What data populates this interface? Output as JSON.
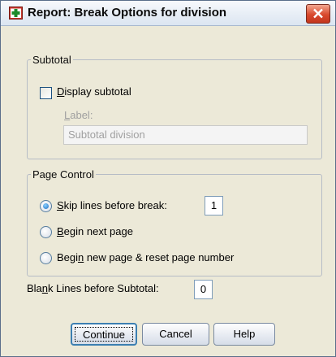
{
  "window": {
    "title": "Report: Break Options for division",
    "icon": "report-icon",
    "close_icon": "close-icon"
  },
  "subtotal": {
    "legend": "Subtotal",
    "display_checkbox": {
      "label": "Display subtotal",
      "checked": false
    },
    "label_caption": "Label:",
    "label_field_value": "Subtotal division"
  },
  "page_control": {
    "legend": "Page Control",
    "options": [
      {
        "label": "Skip lines before break:",
        "checked": true
      },
      {
        "label": "Begin next page",
        "checked": false
      },
      {
        "label": "Begin new page & reset page number",
        "checked": false
      }
    ],
    "skip_lines_value": "1"
  },
  "blank_lines": {
    "label": "Blank Lines before Subtotal:",
    "value": "0"
  },
  "buttons": {
    "continue": "Continue",
    "cancel": "Cancel",
    "help": "Help"
  },
  "colors": {
    "dialog_bg": "#ece9d8",
    "close_button": "#d9492d",
    "default_button_border": "#3c7fb1"
  }
}
